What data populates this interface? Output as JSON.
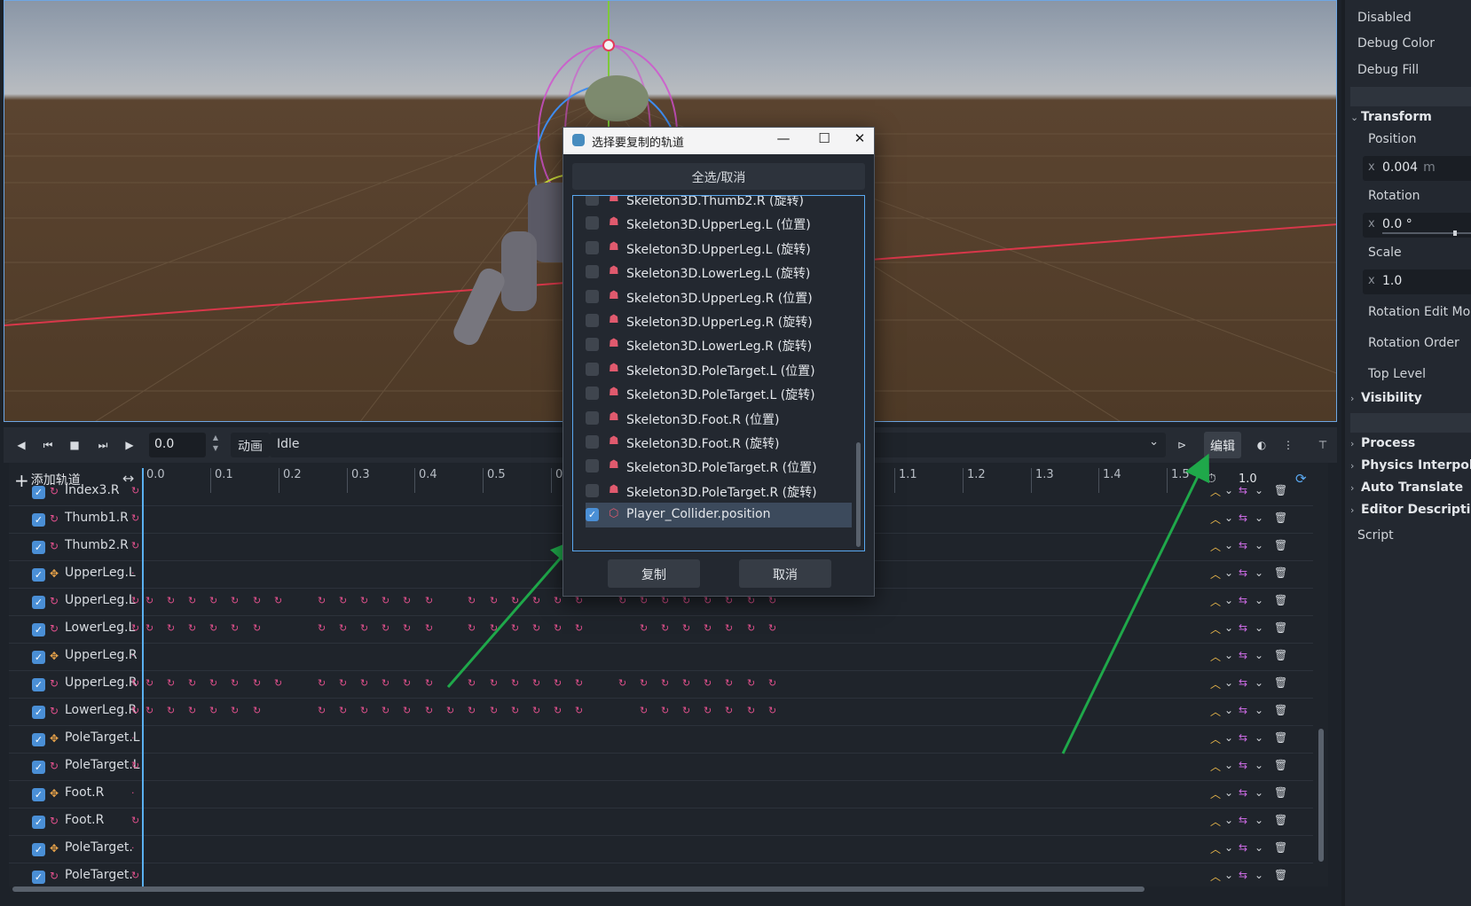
{
  "inspector": {
    "rows_top": [
      "Disabled",
      "Debug Color",
      "Debug Fill"
    ],
    "transform_section": "Transform",
    "position_label": "Position",
    "position_x": "0.004",
    "position_unit": "m",
    "rotation_label": "Rotation",
    "rotation_x": "0.0 °",
    "scale_label": "Scale",
    "scale_x": "1.0",
    "axis_x": "x",
    "rotation_edit_mode": "Rotation Edit Mod",
    "rotation_order": "Rotation Order",
    "top_level": "Top Level",
    "visibility_section": "Visibility",
    "process_section": "Process",
    "physics_section": "Physics Interpolat",
    "auto_translate_section": "Auto Translate",
    "editor_description_section": "Editor Descriptio",
    "script_label": "Script"
  },
  "anim_toolbar": {
    "time_value": "0.0",
    "anim_label": "动画",
    "animation_name": "Idle",
    "edit_button": "编辑"
  },
  "timeline": {
    "add_track": "添加轨道",
    "ticks": [
      "0.0",
      "0.1",
      "0.2",
      "0.3",
      "0.4",
      "0.5",
      "0.",
      "1.1",
      "1.2",
      "1.3",
      "1.4",
      "1.5"
    ],
    "snap_value": "1.0"
  },
  "tracks": [
    {
      "name": "Index3.R",
      "type": "rotation"
    },
    {
      "name": "Thumb1.R",
      "type": "rotation"
    },
    {
      "name": "Thumb2.R",
      "type": "rotation"
    },
    {
      "name": "UpperLeg.L",
      "type": "position"
    },
    {
      "name": "UpperLeg.L",
      "type": "rotation"
    },
    {
      "name": "LowerLeg.L",
      "type": "rotation"
    },
    {
      "name": "UpperLeg.R",
      "type": "position"
    },
    {
      "name": "UpperLeg.R",
      "type": "rotation"
    },
    {
      "name": "LowerLeg.R",
      "type": "rotation"
    },
    {
      "name": "PoleTarget.L",
      "type": "position"
    },
    {
      "name": "PoleTarget.L",
      "type": "rotation"
    },
    {
      "name": "Foot.R",
      "type": "position"
    },
    {
      "name": "Foot.R",
      "type": "rotation"
    },
    {
      "name": "PoleTarget.",
      "type": "position"
    },
    {
      "name": "PoleTarget.",
      "type": "rotation"
    }
  ],
  "dialog": {
    "title": "选择要复制的轨道",
    "select_all": "全选/取消",
    "items": [
      {
        "label": "Skeleton3D.Thumb2.R (旋转)",
        "checked": false
      },
      {
        "label": "Skeleton3D.UpperLeg.L (位置)",
        "checked": false
      },
      {
        "label": "Skeleton3D.UpperLeg.L (旋转)",
        "checked": false
      },
      {
        "label": "Skeleton3D.LowerLeg.L (旋转)",
        "checked": false
      },
      {
        "label": "Skeleton3D.UpperLeg.R (位置)",
        "checked": false
      },
      {
        "label": "Skeleton3D.UpperLeg.R (旋转)",
        "checked": false
      },
      {
        "label": "Skeleton3D.LowerLeg.R (旋转)",
        "checked": false
      },
      {
        "label": "Skeleton3D.PoleTarget.L (位置)",
        "checked": false
      },
      {
        "label": "Skeleton3D.PoleTarget.L (旋转)",
        "checked": false
      },
      {
        "label": "Skeleton3D.Foot.R (位置)",
        "checked": false
      },
      {
        "label": "Skeleton3D.Foot.R (旋转)",
        "checked": false
      },
      {
        "label": "Skeleton3D.PoleTarget.R (位置)",
        "checked": false
      },
      {
        "label": "Skeleton3D.PoleTarget.R (旋转)",
        "checked": false
      },
      {
        "label": "Player_Collider.position",
        "checked": true
      }
    ],
    "copy_button": "复制",
    "cancel_button": "取消"
  },
  "colors": {
    "accent": "#5aa8f0",
    "keyframe": "#e0508c",
    "annotation_arrow": "#1fa84a"
  }
}
